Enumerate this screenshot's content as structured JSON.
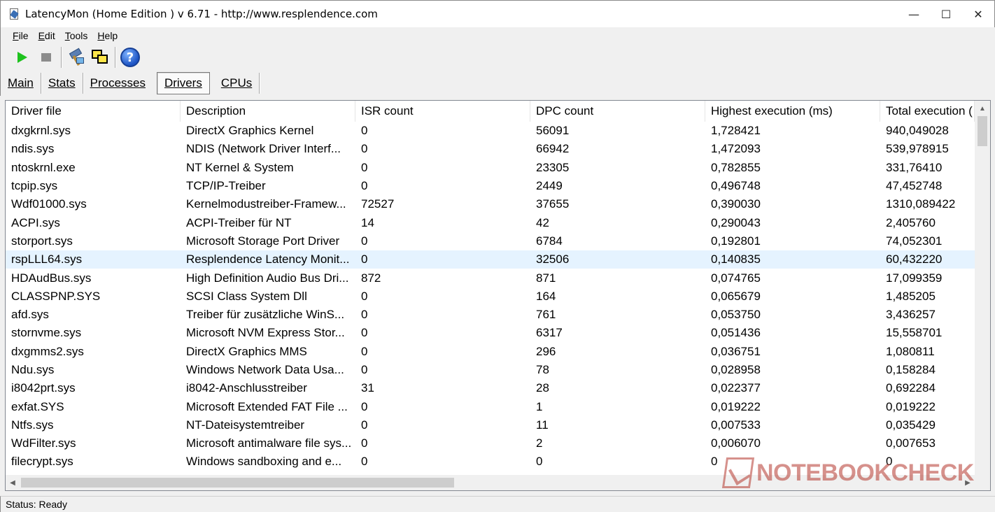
{
  "window": {
    "title": "LatencyMon  (Home Edition )  v 6.71 - http://www.resplendence.com",
    "minimize": "—",
    "maximize": "☐",
    "close": "✕"
  },
  "menu": [
    {
      "first": "F",
      "rest": "ile"
    },
    {
      "first": "E",
      "rest": "dit"
    },
    {
      "first": "T",
      "rest": "ools"
    },
    {
      "first": "H",
      "rest": "elp"
    }
  ],
  "toolbar": {
    "icons": [
      "play-icon",
      "stop-icon",
      "hammer-icon",
      "windows-icon",
      "help-icon"
    ],
    "help_glyph": "?"
  },
  "tabs": [
    {
      "label": "Main",
      "active": false
    },
    {
      "label": "Stats",
      "active": false
    },
    {
      "label": "Processes",
      "active": false
    },
    {
      "label": "Drivers",
      "active": true
    },
    {
      "label": "CPUs",
      "active": false
    }
  ],
  "table": {
    "columns": [
      "Driver file",
      "Description",
      "ISR count",
      "DPC count",
      "Highest execution (ms)",
      "Total execution ("
    ],
    "selected_row": 7,
    "rows": [
      [
        "dxgkrnl.sys",
        "DirectX Graphics Kernel",
        "0",
        "56091",
        "1,728421",
        "940,049028"
      ],
      [
        "ndis.sys",
        "NDIS (Network Driver Interf...",
        "0",
        "66942",
        "1,472093",
        "539,978915"
      ],
      [
        "ntoskrnl.exe",
        "NT Kernel & System",
        "0",
        "23305",
        "0,782855",
        "331,76410"
      ],
      [
        "tcpip.sys",
        "TCP/IP-Treiber",
        "0",
        "2449",
        "0,496748",
        "47,452748"
      ],
      [
        "Wdf01000.sys",
        "Kernelmodustreiber-Framew...",
        "72527",
        "37655",
        "0,390030",
        "1310,089422"
      ],
      [
        "ACPI.sys",
        "ACPI-Treiber für NT",
        "14",
        "42",
        "0,290043",
        "2,405760"
      ],
      [
        "storport.sys",
        "Microsoft Storage Port Driver",
        "0",
        "6784",
        "0,192801",
        "74,052301"
      ],
      [
        "rspLLL64.sys",
        "Resplendence Latency Monit...",
        "0",
        "32506",
        "0,140835",
        "60,432220"
      ],
      [
        "HDAudBus.sys",
        "High Definition Audio Bus Dri...",
        "872",
        "871",
        "0,074765",
        "17,099359"
      ],
      [
        "CLASSPNP.SYS",
        "SCSI Class System Dll",
        "0",
        "164",
        "0,065679",
        "1,485205"
      ],
      [
        "afd.sys",
        "Treiber für zusätzliche WinS...",
        "0",
        "761",
        "0,053750",
        "3,436257"
      ],
      [
        "stornvme.sys",
        "Microsoft NVM Express Stor...",
        "0",
        "6317",
        "0,051436",
        "15,558701"
      ],
      [
        "dxgmms2.sys",
        "DirectX Graphics MMS",
        "0",
        "296",
        "0,036751",
        "1,080811"
      ],
      [
        "Ndu.sys",
        "Windows Network Data Usa...",
        "0",
        "78",
        "0,028958",
        "0,158284"
      ],
      [
        "i8042prt.sys",
        "i8042-Anschlusstreiber",
        "31",
        "28",
        "0,022377",
        "0,692284"
      ],
      [
        "exfat.SYS",
        "Microsoft Extended FAT File ...",
        "0",
        "1",
        "0,019222",
        "0,019222"
      ],
      [
        "Ntfs.sys",
        "NT-Dateisystemtreiber",
        "0",
        "11",
        "0,007533",
        "0,035429"
      ],
      [
        "WdFilter.sys",
        "Microsoft antimalware file sys...",
        "0",
        "2",
        "0,006070",
        "0,007653"
      ],
      [
        "filecrypt.sys",
        "Windows sandboxing and e...",
        "0",
        "0",
        "0",
        "0"
      ]
    ]
  },
  "status": "Status: Ready",
  "watermark": "NOTEBOOKCHECK",
  "colors": {
    "selected_row": "#e5f3ff",
    "play": "#1ec21e",
    "watermark": "#b5392f"
  }
}
